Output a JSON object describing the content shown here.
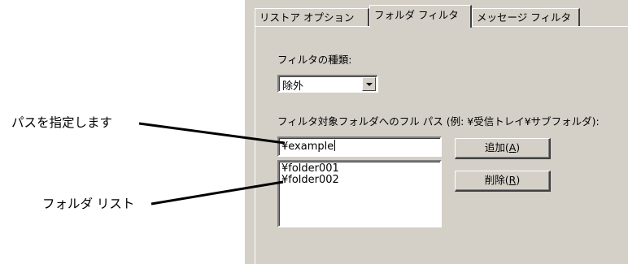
{
  "tabs": [
    {
      "label": "リストア オプション",
      "active": false
    },
    {
      "label": "フォルダ フィルタ",
      "active": true
    },
    {
      "label": "メッセージ フィルタ",
      "active": false
    }
  ],
  "filter_type": {
    "label": "フィルタの種類:",
    "selected": "除外"
  },
  "folder_path": {
    "label": "フィルタ対象フォルダへのフル パス (例: ¥受信トレイ¥サブフォルダ):",
    "value": "¥example"
  },
  "folder_list": {
    "items": [
      "¥folder001",
      "¥folder002"
    ]
  },
  "buttons": {
    "add": {
      "text": "追加(",
      "mnemonic": "A",
      "close": ")"
    },
    "delete": {
      "text": "削除(",
      "mnemonic": "R",
      "close": ")"
    }
  },
  "annotations": {
    "path_note": "パスを指定します",
    "list_note": "フォルダ リスト"
  },
  "colors": {
    "dialog_face": "#d4d0c8",
    "highlight": "#ffffff",
    "shadow": "#808080",
    "dark_shadow": "#404040",
    "leader_line": "#000000"
  }
}
